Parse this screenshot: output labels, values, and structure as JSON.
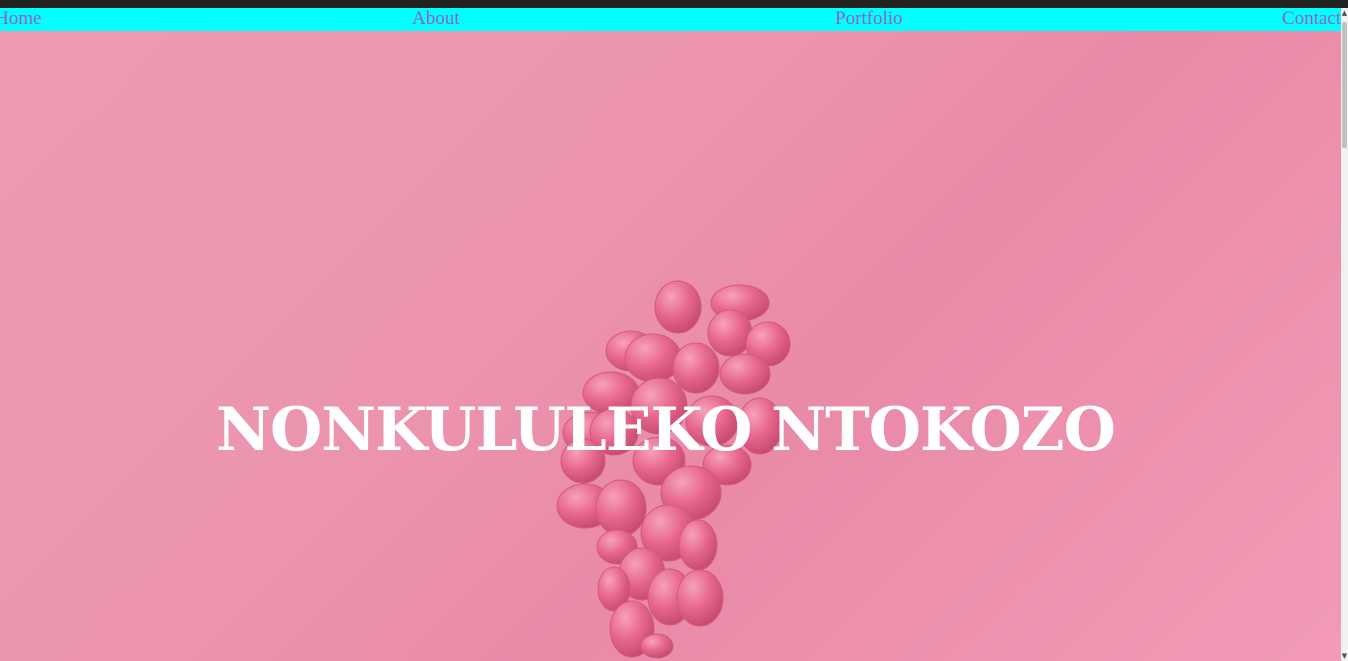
{
  "nav": {
    "items": [
      {
        "label": "Home"
      },
      {
        "label": "About"
      },
      {
        "label": "Portfolio"
      },
      {
        "label": "Contact"
      }
    ]
  },
  "hero": {
    "title": "NONKULULEKO NTOKOZO",
    "background_image": "pink-grapes-photo"
  },
  "colors": {
    "navbar_bg": "#00ffff",
    "nav_link": "#9a5bc0",
    "hero_bg": "#ec94ae",
    "hero_title": "#ffffff",
    "grape": "#e8688d"
  },
  "icons": {
    "scroll_up": "▲",
    "scroll_down": "▼"
  }
}
